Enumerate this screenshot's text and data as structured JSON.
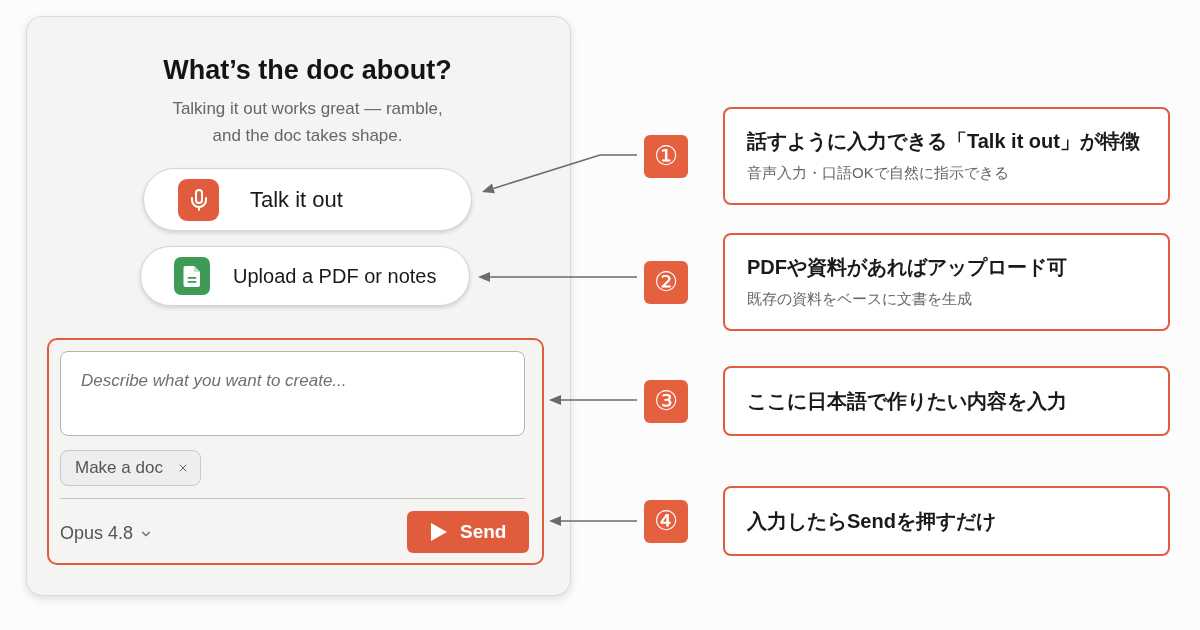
{
  "card": {
    "title": "What’s the doc about?",
    "subtitle": "Talking it out works great — ramble,\nand the doc takes shape.",
    "actions": [
      {
        "kind": "voice",
        "label": "Talk it out"
      },
      {
        "kind": "upload",
        "label": "Upload a PDF or notes"
      }
    ],
    "composer": {
      "placeholder": "Describe what you want to create...",
      "chips": [
        {
          "label": "Make a doc"
        }
      ],
      "model": "Opus 4.8",
      "send": "Send"
    }
  },
  "callouts": [
    {
      "badge": "①",
      "title": "話すように入力できる「Talk it out」が特徴",
      "note": "音声入力・口語OKで自然に指示できる"
    },
    {
      "badge": "②",
      "title": "PDFや資料があればアップロード可",
      "note": "既存の資料をベースに文書を生成"
    },
    {
      "badge": "③",
      "title": "ここに日本語で作りたい内容を入力"
    },
    {
      "badge": "④",
      "title": "入力したらSendを押すだけ"
    }
  ]
}
